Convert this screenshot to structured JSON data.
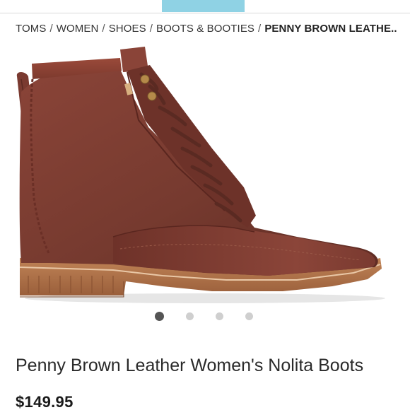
{
  "breadcrumb": {
    "items": [
      "TOMS",
      "WOMEN",
      "SHOES",
      "BOOTS & BOOTIES"
    ],
    "separator": "/",
    "current": "PENNY BROWN LEATHE..."
  },
  "product": {
    "title": "Penny Brown Leather Women's Nolita Boots",
    "price": "$149.95",
    "image_icon": "boot-product-image"
  },
  "carousel": {
    "total": 4,
    "active_index": 0
  },
  "colors": {
    "accent_tab": "#8fd2e4",
    "leather": "#7a3a30",
    "sole": "#b0714a",
    "dot_active": "#555555",
    "dot_inactive": "#cfcfcf"
  }
}
